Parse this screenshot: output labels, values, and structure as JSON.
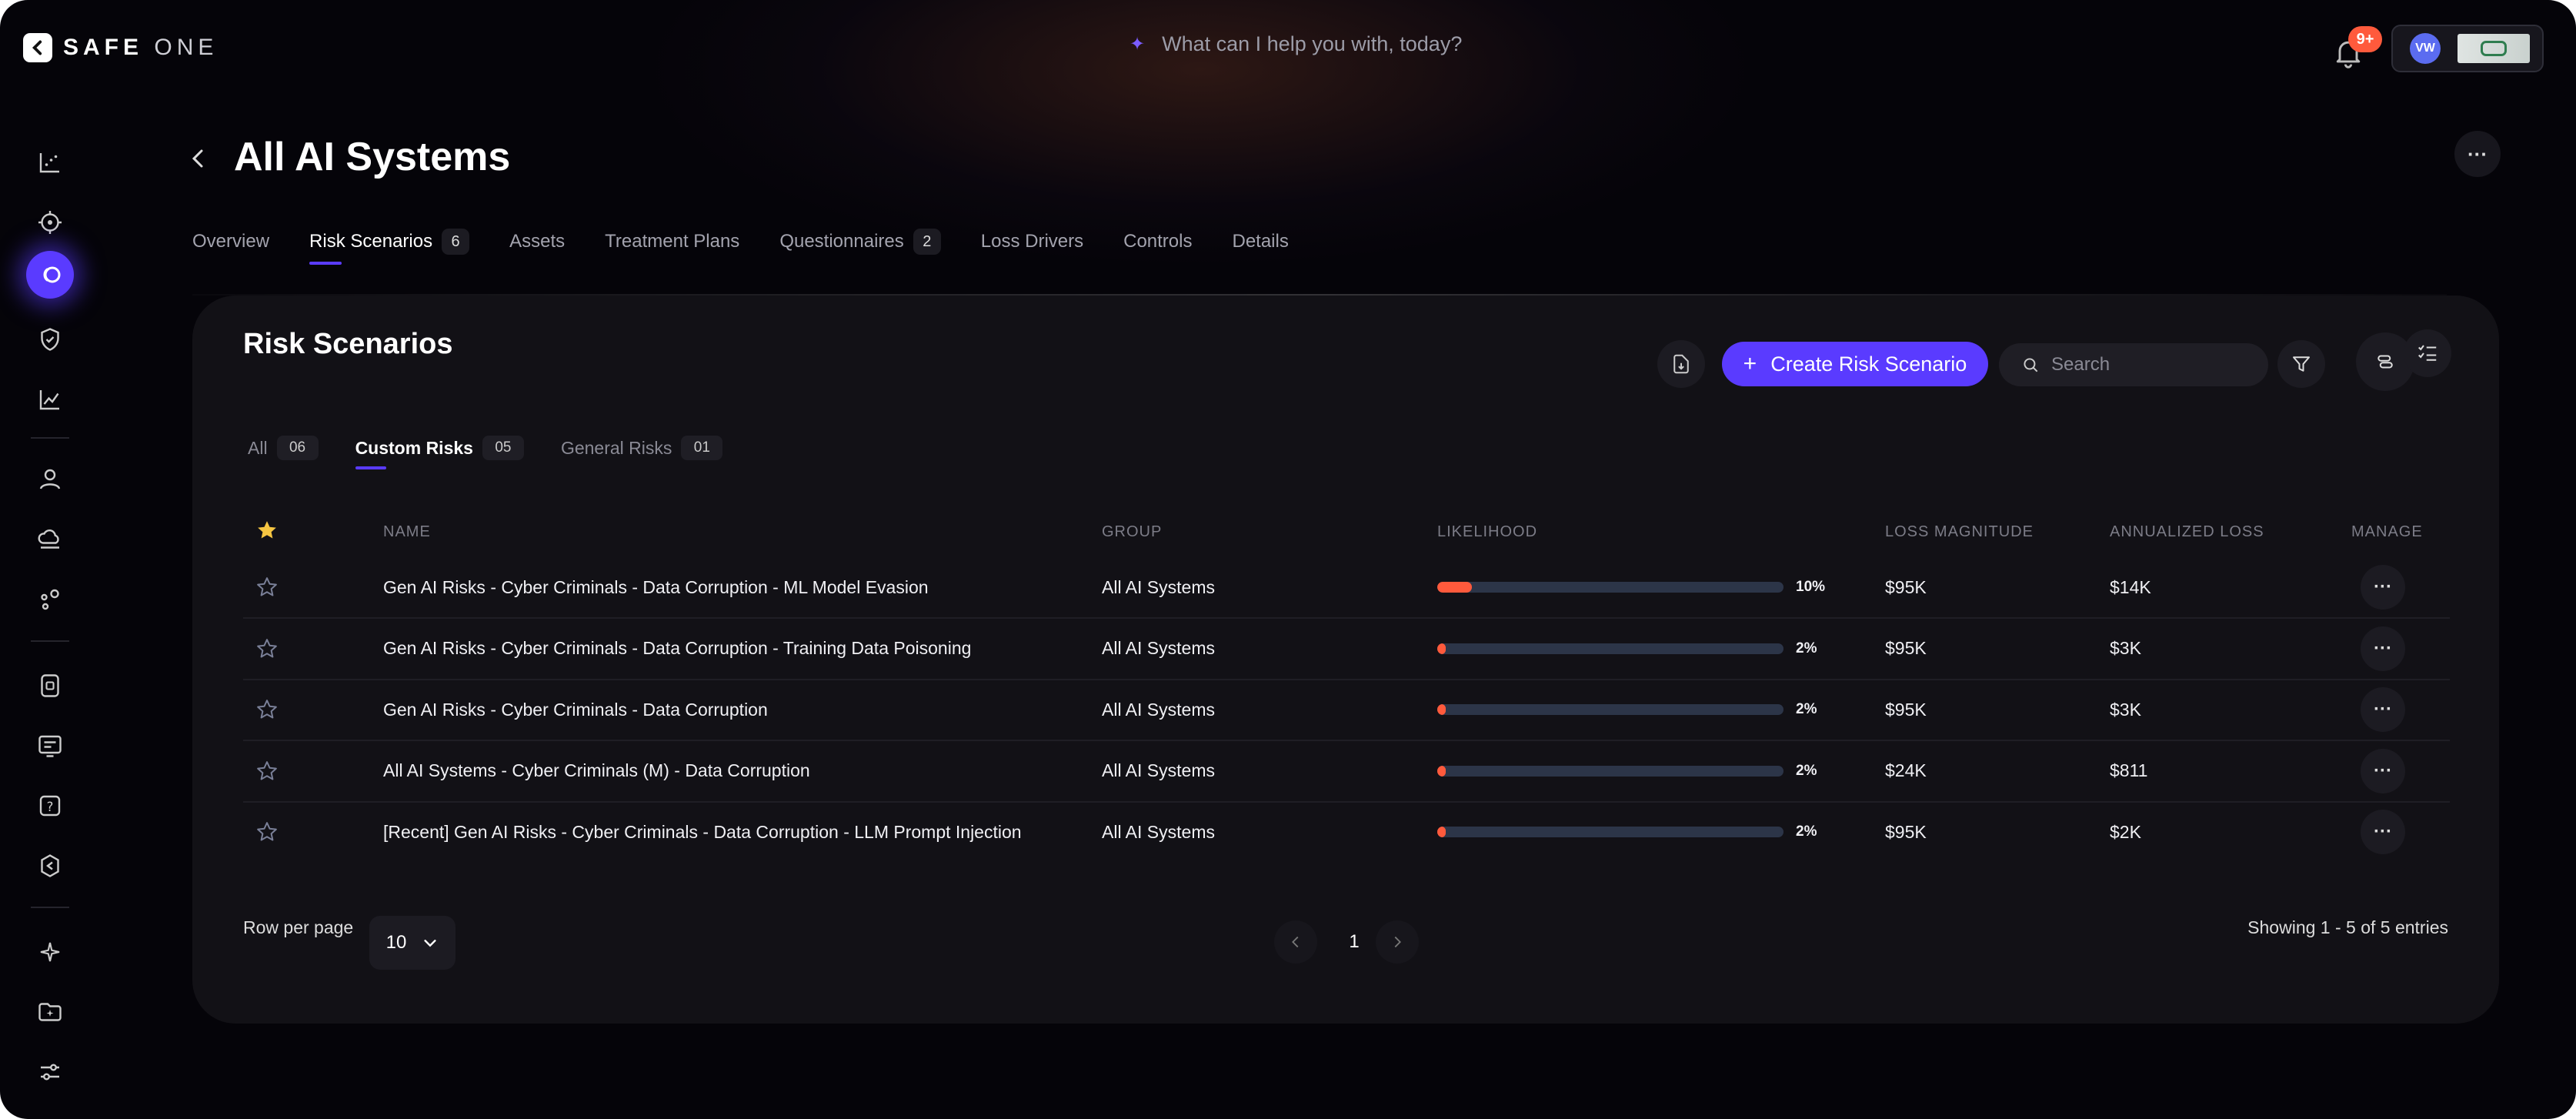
{
  "brand": {
    "name_bold": "SAFE",
    "name_thin": "ONE"
  },
  "assistant": {
    "prompt": "What can I help you with, today?"
  },
  "notifications": {
    "count": "9+"
  },
  "account": {
    "initials": "VW"
  },
  "page": {
    "title": "All AI Systems"
  },
  "tabs": [
    {
      "label": "Overview",
      "count": ""
    },
    {
      "label": "Risk Scenarios",
      "count": "6"
    },
    {
      "label": "Assets",
      "count": ""
    },
    {
      "label": "Treatment Plans",
      "count": ""
    },
    {
      "label": "Questionnaires",
      "count": "2"
    },
    {
      "label": "Loss Drivers",
      "count": ""
    },
    {
      "label": "Controls",
      "count": ""
    },
    {
      "label": "Details",
      "count": ""
    }
  ],
  "card": {
    "title": "Risk Scenarios",
    "create_label": "Create Risk Scenario",
    "search_placeholder": "Search"
  },
  "subtabs": [
    {
      "label": "All",
      "count": "06"
    },
    {
      "label": "Custom Risks",
      "count": "05"
    },
    {
      "label": "General Risks",
      "count": "01"
    }
  ],
  "columns": {
    "name": "NAME",
    "group": "GROUP",
    "likelihood": "LIKELIHOOD",
    "loss_magnitude": "LOSS MAGNITUDE",
    "annualized_loss": "ANNUALIZED LOSS",
    "manage": "MANAGE"
  },
  "rows": [
    {
      "name": "Gen AI Risks - Cyber Criminals - Data Corruption - ML Model Evasion",
      "group": "All AI Systems",
      "likelihood": 0.1,
      "likelihood_label": "10%",
      "loss_magnitude": "$95K",
      "annualized_loss": "$14K"
    },
    {
      "name": "Gen AI Risks - Cyber Criminals - Data Corruption - Training Data Poisoning",
      "group": "All AI Systems",
      "likelihood": 0.02,
      "likelihood_label": "2%",
      "loss_magnitude": "$95K",
      "annualized_loss": "$3K"
    },
    {
      "name": "Gen AI Risks - Cyber Criminals - Data Corruption",
      "group": "All AI Systems",
      "likelihood": 0.02,
      "likelihood_label": "2%",
      "loss_magnitude": "$95K",
      "annualized_loss": "$3K"
    },
    {
      "name": "All AI Systems - Cyber Criminals (M) - Data Corruption",
      "group": "All AI Systems",
      "likelihood": 0.02,
      "likelihood_label": "2%",
      "loss_magnitude": "$24K",
      "annualized_loss": "$811"
    },
    {
      "name": "[Recent] Gen AI Risks - Cyber Criminals - Data Corruption - LLM Prompt Injection",
      "group": "All AI Systems",
      "likelihood": 0.02,
      "likelihood_label": "2%",
      "loss_magnitude": "$95K",
      "annualized_loss": "$2K"
    }
  ],
  "pagination": {
    "rows_label": "Row per page",
    "rows_value": "10",
    "current_page": "1",
    "showing": "Showing 1 - 5 of 5 entries"
  },
  "colors": {
    "accent": "#5a3bff",
    "bar_fill": "#ff5a3c",
    "bar_track": "#2c3548",
    "star": "#f5c542"
  }
}
